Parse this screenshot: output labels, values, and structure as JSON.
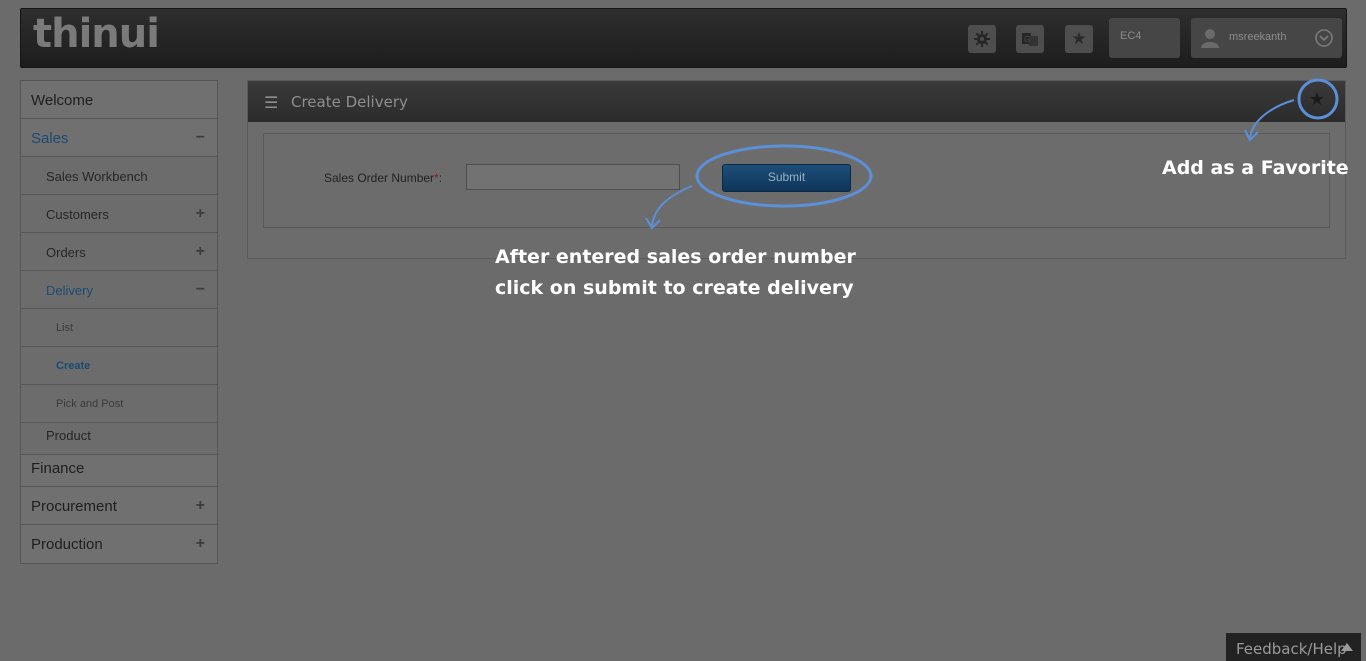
{
  "header": {
    "logo": "thinui",
    "client": "EC4",
    "username": "msreekanth"
  },
  "icons": {
    "settings": "gear-icon",
    "language": "translate-icon",
    "favorites": "star-icon",
    "user": "user-icon",
    "user_menu": "chevron-down-circle-icon",
    "menu": "hamburger-icon",
    "feedback": "triangle-up-icon"
  },
  "sidebar": {
    "items": [
      {
        "label": "Welcome",
        "level": 1
      },
      {
        "label": "Sales",
        "level": 1,
        "sign": "−"
      },
      {
        "label": "Sales Workbench",
        "level": 2
      },
      {
        "label": "Customers",
        "level": 2,
        "sign": "+"
      },
      {
        "label": "Orders",
        "level": 2,
        "sign": "+"
      },
      {
        "label": "Delivery",
        "level": 2,
        "sign": "−"
      },
      {
        "label": "List",
        "level": 3
      },
      {
        "label": "Create",
        "level": 3
      },
      {
        "label": "Pick and Post",
        "level": 3
      },
      {
        "label": "Product",
        "level": 2
      },
      {
        "label": "Finance",
        "level": 1
      },
      {
        "label": "Procurement",
        "level": 1,
        "sign": "+"
      },
      {
        "label": "Production",
        "level": 1,
        "sign": "+"
      }
    ]
  },
  "panel": {
    "title": "Create Delivery",
    "field_label": "Sales Order Number",
    "required_mark": "*",
    "label_colon": ":",
    "field_value": "",
    "submit_label": "Submit"
  },
  "callouts": {
    "favorite": "Add as a Favorite",
    "submit_line1": "After entered sales order number",
    "submit_line2": "click on submit to create delivery"
  },
  "feedback": {
    "label": "Feedback/Help"
  },
  "colors": {
    "highlight_ring": "#5b8fd6",
    "submit_button": "#1d4f78",
    "active_nav": "#1c4a73"
  }
}
